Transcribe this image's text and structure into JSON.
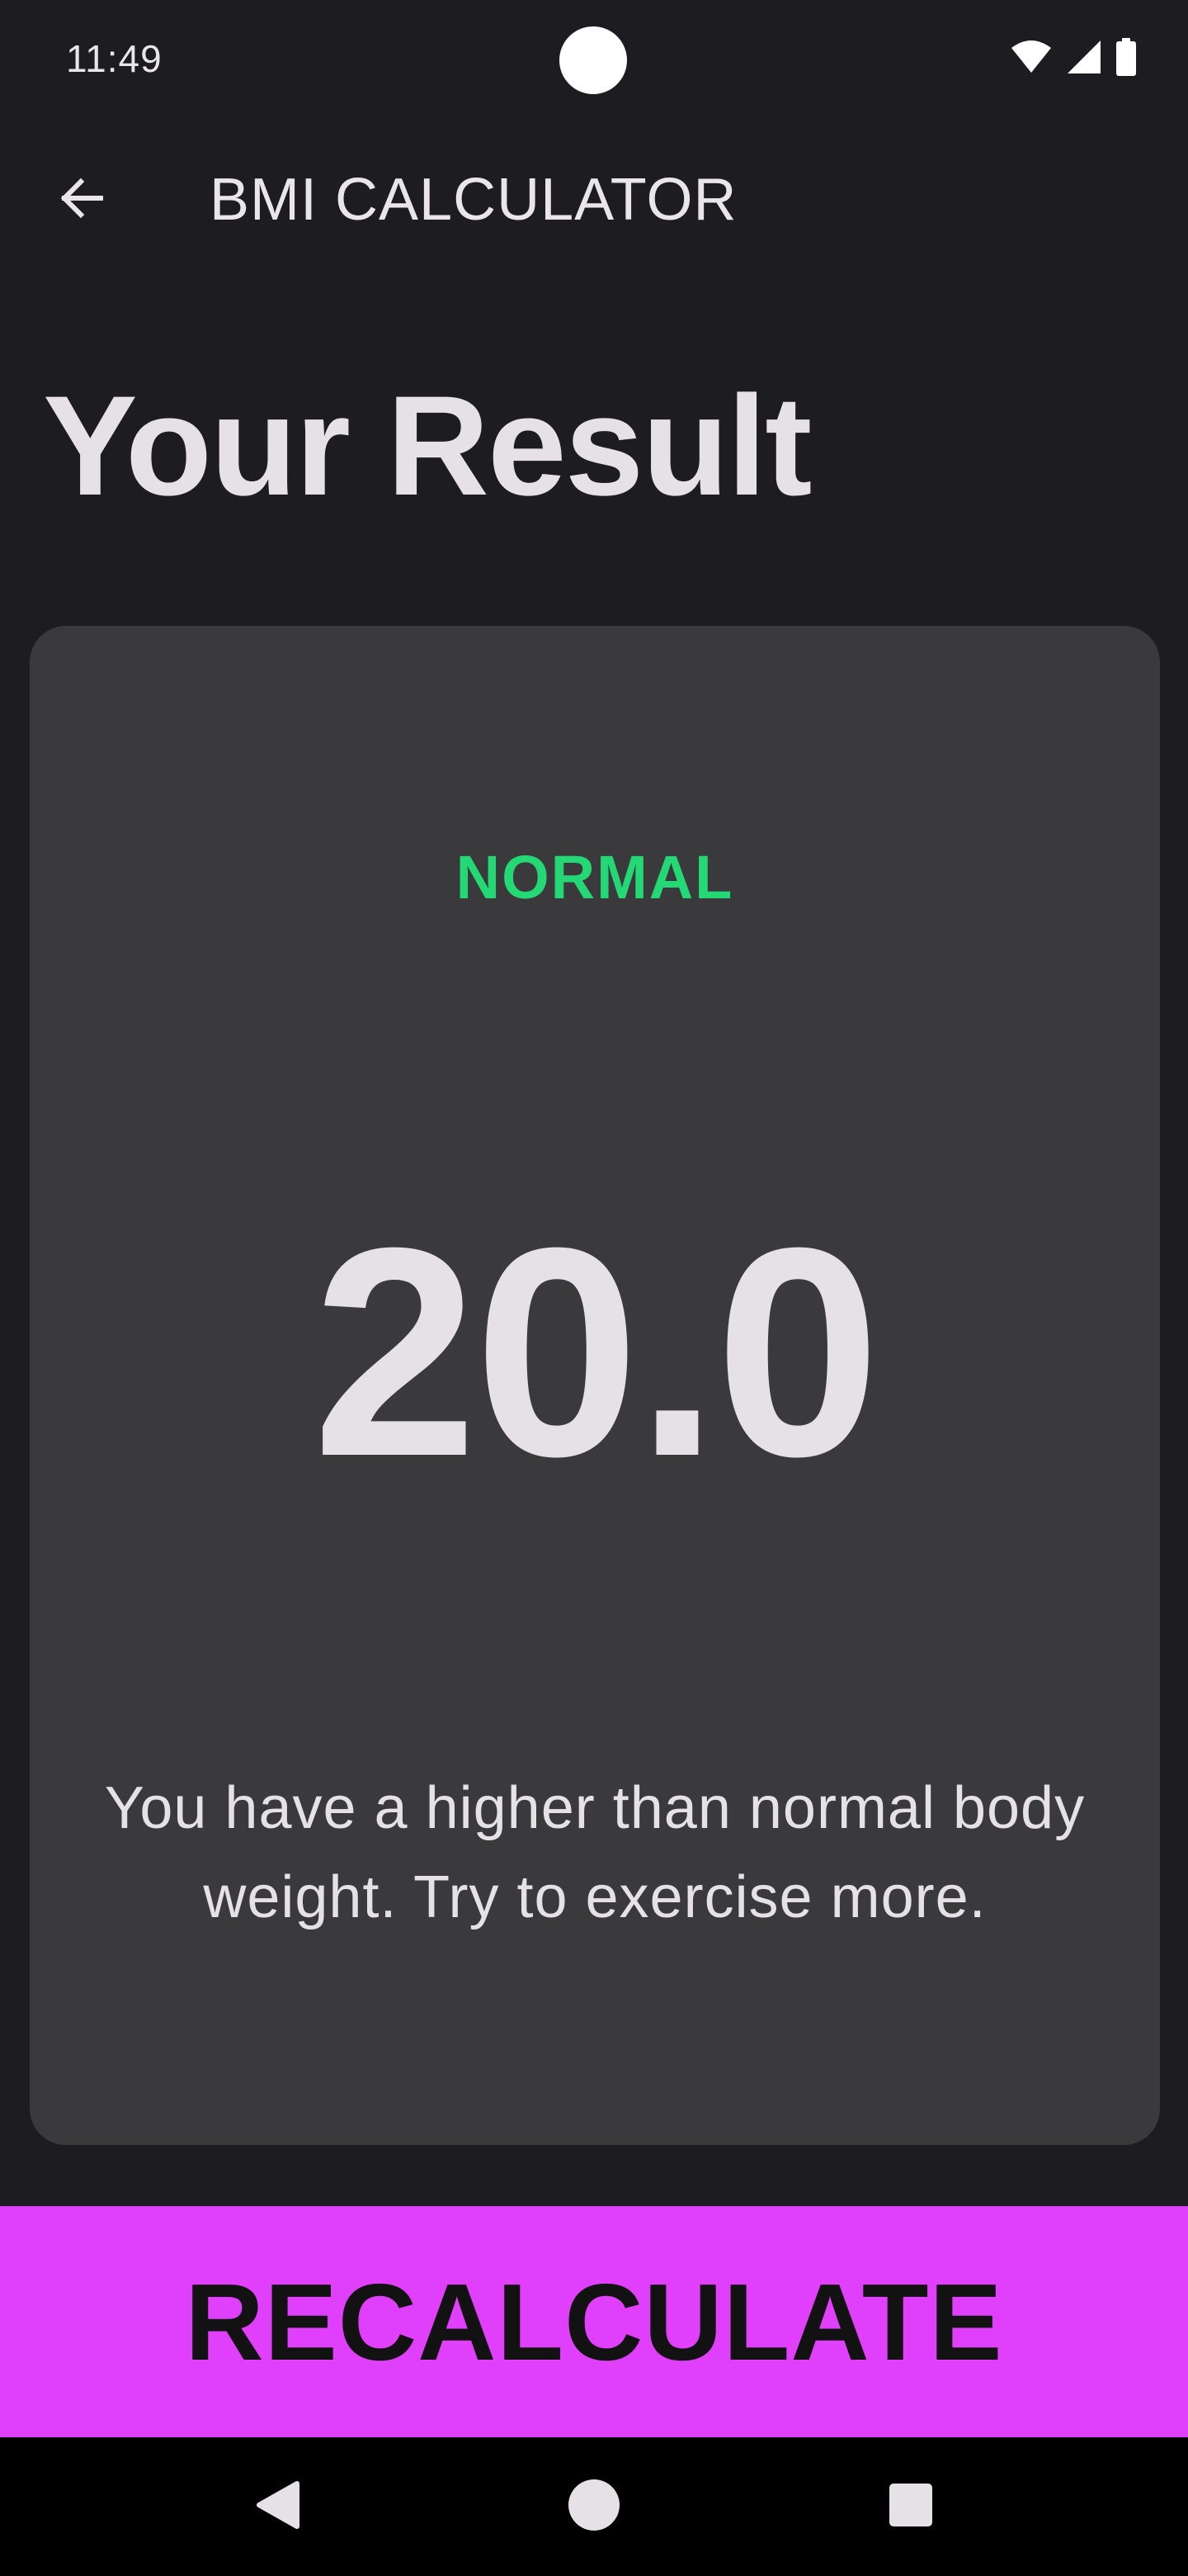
{
  "status_bar": {
    "time": "11:49",
    "icons": [
      "wifi-icon",
      "cell-signal-icon",
      "battery-icon"
    ]
  },
  "app_bar": {
    "back_icon": "arrow-left-icon",
    "title": "BMI CALCULATOR"
  },
  "page": {
    "title": "Your Result"
  },
  "result": {
    "status": "NORMAL",
    "value": "20.0",
    "advice": "You have a higher than normal body weight. Try to exercise more."
  },
  "actions": {
    "recalculate_label": "RECALCULATE"
  },
  "nav_bar": {
    "icons": [
      "nav-back-icon",
      "nav-home-icon",
      "nav-recents-icon"
    ]
  },
  "colors": {
    "background": "#1d1c21",
    "card": "#3a3a3c",
    "status_normal": "#24d876",
    "button": "#e040fb",
    "text": "#e6e1e6"
  }
}
